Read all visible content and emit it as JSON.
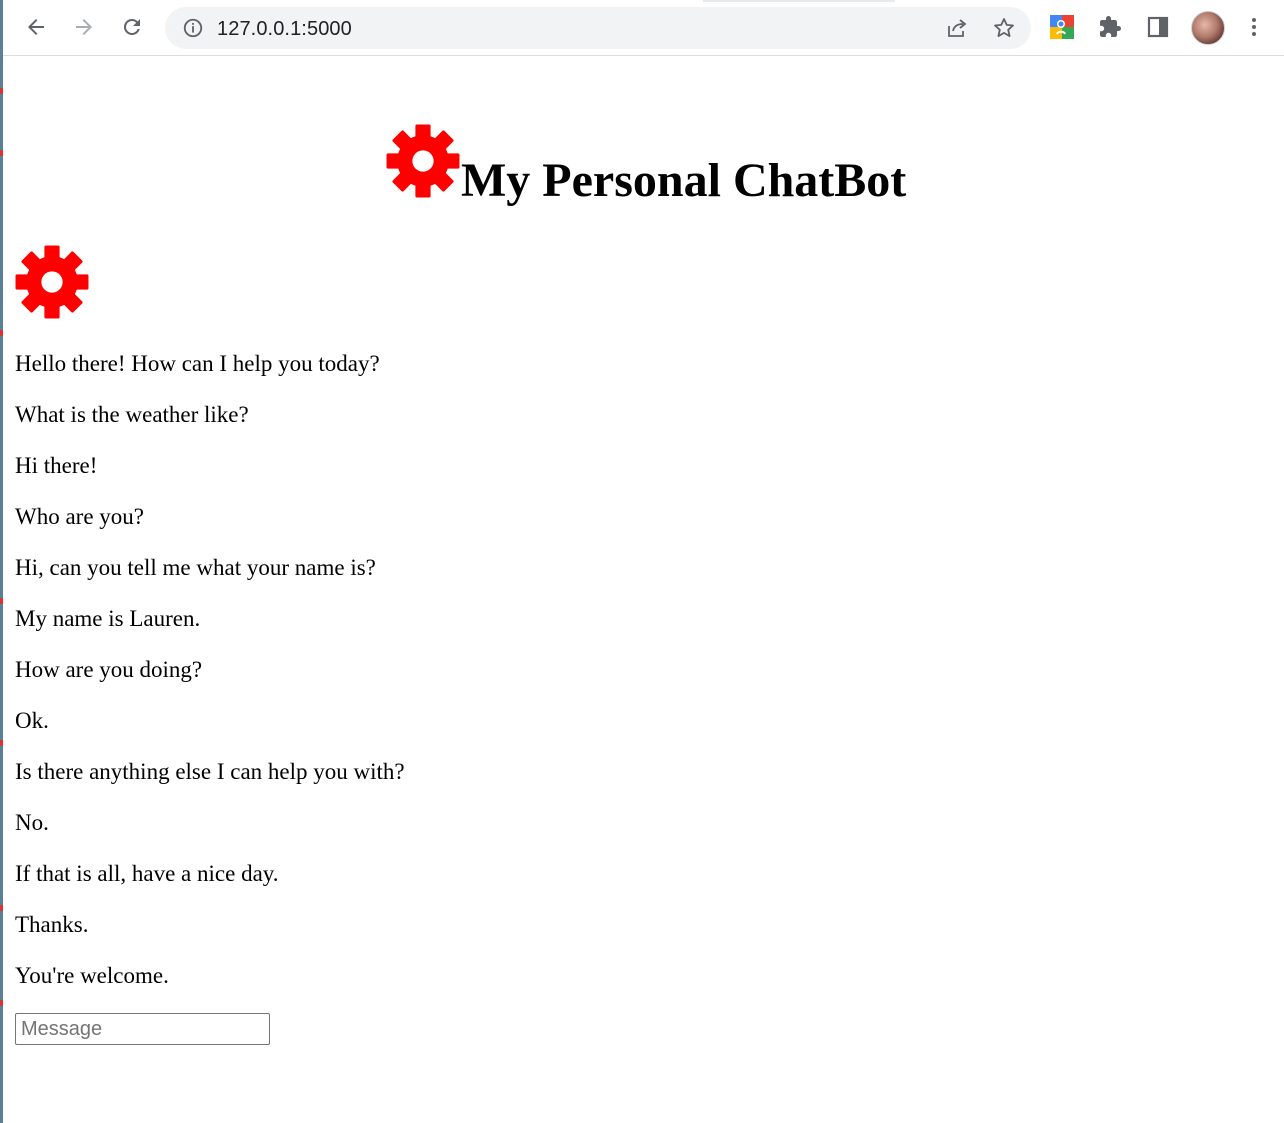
{
  "browser": {
    "url": "127.0.0.1:5000",
    "icons": {
      "back": "arrow-left-icon",
      "forward": "arrow-right-icon",
      "reload": "reload-icon",
      "site_info": "info-icon",
      "share": "share-icon",
      "bookmark": "star-icon",
      "extension_google": "google-extension-icon",
      "extensions": "puzzle-icon",
      "side_panel": "side-panel-icon",
      "menu": "kebab-menu-icon"
    }
  },
  "page": {
    "title": "My Personal ChatBot",
    "gear_color": "#ff0000",
    "messages": [
      "Hello there! How can I help you today?",
      "What is the weather like?",
      "Hi there!",
      "Who are you?",
      "Hi, can you tell me what your name is?",
      "My name is Lauren.",
      "How are you doing?",
      "Ok.",
      "Is there anything else I can help you with?",
      "No.",
      "If that is all, have a nice day.",
      "Thanks.",
      "You're welcome."
    ],
    "input": {
      "placeholder": "Message",
      "value": ""
    }
  }
}
